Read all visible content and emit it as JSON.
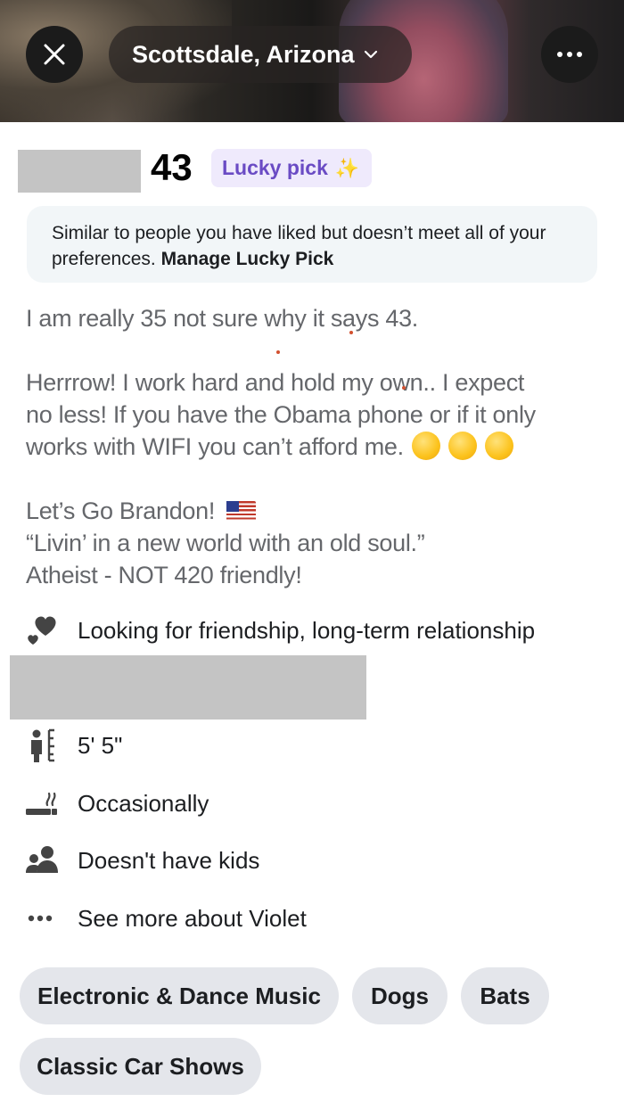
{
  "header": {
    "location_label": "Scottsdale, Arizona"
  },
  "profile": {
    "age": "43",
    "badge": {
      "label": "Lucky pick",
      "sparkle": "✨"
    },
    "info_box": {
      "text": "Similar to people you have liked but doesn’t meet all of your preferences.",
      "link": "Manage Lucky Pick"
    },
    "bio": {
      "line1": "I am really 35 not sure why it says 43.",
      "line2": "Herrrow! I work hard and hold my own.. I expect",
      "line3": "no less! If you have the Obama phone or if it only",
      "line4": "works with WIFI you can’t afford me.",
      "line5": "Let’s Go Brandon!",
      "line6": "“Livin’ in a new world with an old soul.”",
      "line7": "Atheist - NOT 420 friendly!"
    },
    "attributes": {
      "looking_for": "Looking for friendship, long-term relationship",
      "height": "5' 5\"",
      "smoking": "Occasionally",
      "kids": "Doesn't have kids",
      "see_more": "See more about Violet"
    },
    "interests": [
      "Electronic & Dance Music",
      "Dogs",
      "Bats",
      "Classic Car Shows"
    ]
  },
  "icons": {
    "close": "close-icon",
    "chevron": "chevron-down-icon",
    "more": "more-dots-icon",
    "hearts": "hearts-icon",
    "height": "height-ruler-icon",
    "smoking": "cigarette-icon",
    "kids": "people-icon",
    "see_more": "ellipsis-icon"
  },
  "colors": {
    "badge_bg": "#efeafc",
    "badge_text": "#6a4bc4",
    "info_bg": "#f2f6f8",
    "chip_bg": "#e4e6eb",
    "bio_text": "#65676b"
  }
}
